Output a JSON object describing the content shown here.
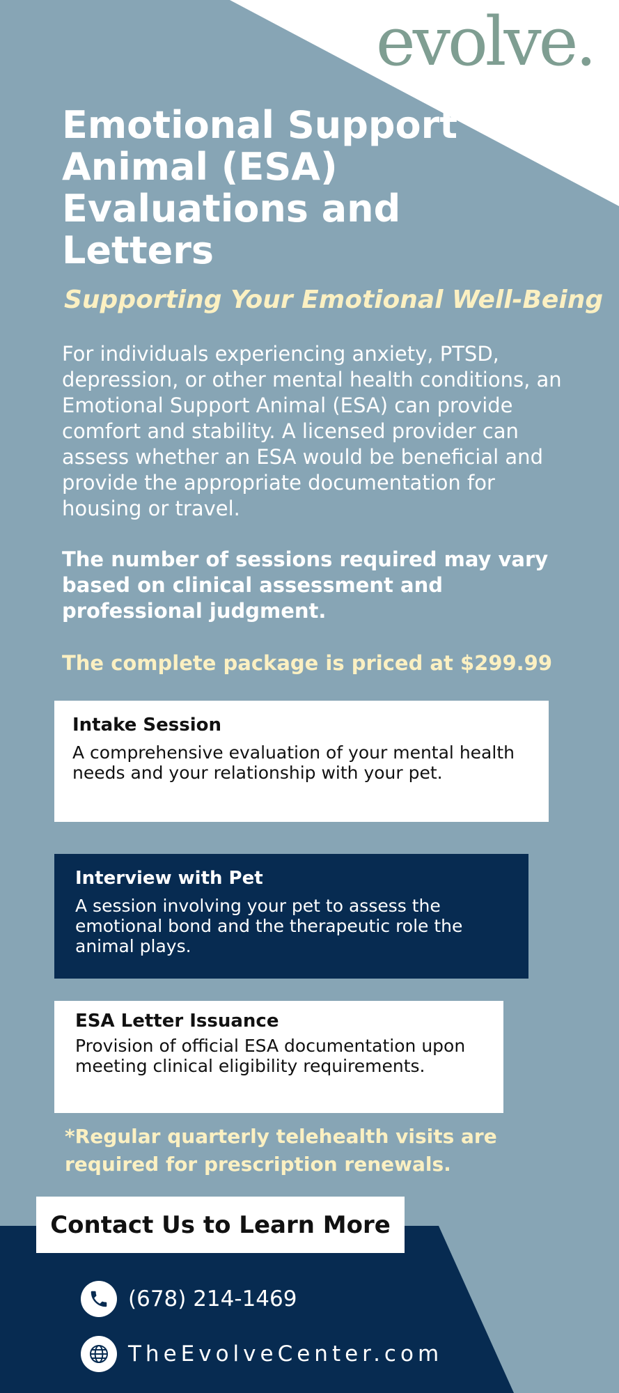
{
  "brand": {
    "logo_text": "evolve.",
    "colors": {
      "background": "#87a5b5",
      "navy": "#072b51",
      "cream": "#fbf0c2",
      "logo_green": "#7f9e92",
      "white": "#ffffff"
    }
  },
  "header": {
    "title": "Emotional Support Animal (ESA) Evaluations and Letters",
    "subtitle": "Supporting Your Emotional Well-Being"
  },
  "intro": {
    "text": "For individuals experiencing anxiety, PTSD, depression, or other mental health conditions, an Emotional Support Animal (ESA) can provide comfort and stability. A licensed provider can assess whether an ESA would be beneficial and provide the appropriate documentation for housing or travel."
  },
  "sessions_note": "The number of sessions required may vary based on clinical assessment and professional judgment.",
  "price_text": "The complete package is priced at $299.99",
  "services": [
    {
      "title": "Intake Session",
      "description": "A comprehensive evaluation of your mental health needs and your relationship with your pet."
    },
    {
      "title": "Interview with Pet",
      "description": "A session involving your pet to assess the emotional bond and the therapeutic role the animal plays."
    },
    {
      "title": "ESA Letter Issuance",
      "description": "Provision of official ESA documentation upon meeting clinical eligibility requirements."
    }
  ],
  "footnote": "*Regular quarterly telehealth visits are required for prescription renewals.",
  "contact": {
    "button_label": "Contact Us to Learn More",
    "phone": "(678) 214-1469",
    "phone_icon": "phone-icon",
    "website": "TheEvolveCenter.com",
    "website_icon": "globe-icon"
  }
}
